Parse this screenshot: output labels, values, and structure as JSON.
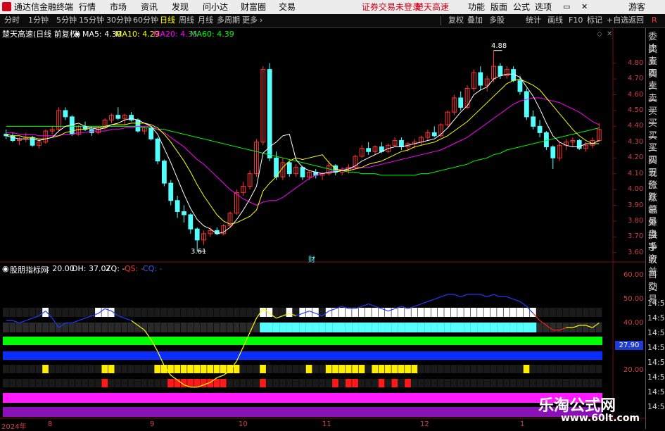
{
  "menu": {
    "app_title": "通达信金融终端",
    "items": [
      "行情",
      "市场",
      "资讯",
      "发现",
      "问小达",
      "财富圈",
      "交易"
    ],
    "notice": "证券交易未登录",
    "stock": "楚天高速",
    "right_items": [
      "功能",
      "版面",
      "公式",
      "选项"
    ],
    "user": "游客"
  },
  "toolbar": {
    "periods": [
      "分时",
      "1分钟",
      "5分钟",
      "15分钟",
      "30分钟",
      "60分钟",
      "日线",
      "周线",
      "月线",
      "多周期",
      "更多"
    ],
    "active_period": "日线",
    "right_buttons": [
      "复权",
      "叠加",
      "多股",
      "统计",
      "画线",
      "F10",
      "标记",
      "+自选",
      "返回"
    ]
  },
  "chart_header": {
    "title": "楚天高速(日线 前复权)",
    "ma5": "MA5: 4.30",
    "ma10": "MA10: 4.29",
    "ma20": "MA20: 4.35",
    "ma60": "MA60: 4.39"
  },
  "indicator_header": {
    "name": "股朋指标网",
    "v1": ": 20.00",
    "dh": "DH: 37.07",
    "zq": "ZQ: -",
    "qs": "QS: -",
    "cq": "CQ: -"
  },
  "price_axis": [
    "4.80",
    "4.70",
    "4.60",
    "4.50",
    "4.40",
    "4.30",
    "4.20",
    "4.10",
    "4.00",
    "3.90",
    "3.80",
    "3.70",
    "3.60"
  ],
  "ind_axis": [
    "60.00",
    "50.00",
    "40.00",
    "20.00"
  ],
  "ind_current": "27.90",
  "annotations": {
    "high": "4.88",
    "low": "3.61",
    "cai": "财"
  },
  "date_axis": [
    "2024年",
    "8",
    "9",
    "10",
    "11",
    "12",
    "1"
  ],
  "right_panel": {
    "labels": [
      "委比",
      "卖五",
      "卖四",
      "卖三",
      "卖二",
      "卖一",
      "买一",
      "买二",
      "买三",
      "买四",
      "买五",
      "现价",
      "涨跌",
      "涨幅",
      "总量",
      "外盘",
      "换手",
      "净资",
      "收益"
    ],
    "side": [
      "自动",
      "交易"
    ],
    "times": [
      "14:56",
      "14:56",
      "14:56",
      "14:56",
      "14:56",
      "14:56",
      "14:56",
      "14:56"
    ]
  },
  "watermark": {
    "title": "乐淘公式网",
    "url": "www.60lt.com"
  },
  "colors": {
    "up": "#ff3232",
    "down": "#54ffff",
    "ma5": "#ffffff",
    "ma10": "#ffff00",
    "ma20": "#ff00ff",
    "ma60": "#00ff00"
  },
  "chart_data": {
    "type": "candlestick",
    "ylim": [
      3.55,
      4.95
    ],
    "ohlc": [
      [
        4.35,
        4.38,
        4.32,
        4.34
      ],
      [
        4.34,
        4.36,
        4.3,
        4.31
      ],
      [
        4.31,
        4.33,
        4.28,
        4.32
      ],
      [
        4.32,
        4.36,
        4.3,
        4.33
      ],
      [
        4.33,
        4.34,
        4.27,
        4.28
      ],
      [
        4.28,
        4.32,
        4.26,
        4.3
      ],
      [
        4.3,
        4.38,
        4.29,
        4.37
      ],
      [
        4.37,
        4.4,
        4.35,
        4.38
      ],
      [
        4.38,
        4.52,
        4.37,
        4.5
      ],
      [
        4.5,
        4.52,
        4.44,
        4.46
      ],
      [
        4.46,
        4.47,
        4.34,
        4.35
      ],
      [
        4.35,
        4.41,
        4.34,
        4.4
      ],
      [
        4.4,
        4.43,
        4.37,
        4.38
      ],
      [
        4.38,
        4.4,
        4.34,
        4.36
      ],
      [
        4.36,
        4.4,
        4.35,
        4.39
      ],
      [
        4.39,
        4.45,
        4.38,
        4.44
      ],
      [
        4.44,
        4.48,
        4.42,
        4.47
      ],
      [
        4.47,
        4.52,
        4.44,
        4.45
      ],
      [
        4.45,
        4.48,
        4.41,
        4.47
      ],
      [
        4.47,
        4.49,
        4.43,
        4.44
      ],
      [
        4.44,
        4.45,
        4.36,
        4.37
      ],
      [
        4.37,
        4.4,
        4.35,
        4.39
      ],
      [
        4.39,
        4.4,
        4.31,
        4.32
      ],
      [
        4.32,
        4.33,
        4.16,
        4.18
      ],
      [
        4.18,
        4.19,
        4.02,
        4.04
      ],
      [
        4.04,
        4.06,
        3.9,
        3.93
      ],
      [
        3.93,
        3.96,
        3.82,
        3.86
      ],
      [
        3.86,
        3.9,
        3.79,
        3.84
      ],
      [
        3.84,
        3.85,
        3.72,
        3.75
      ],
      [
        3.75,
        3.76,
        3.61,
        3.68
      ],
      [
        3.68,
        3.74,
        3.65,
        3.72
      ],
      [
        3.72,
        3.76,
        3.7,
        3.74
      ],
      [
        3.74,
        3.76,
        3.71,
        3.72
      ],
      [
        3.72,
        3.78,
        3.71,
        3.77
      ],
      [
        3.77,
        3.86,
        3.76,
        3.85
      ],
      [
        3.85,
        4.0,
        3.84,
        3.98
      ],
      [
        3.98,
        4.05,
        3.96,
        4.02
      ],
      [
        4.02,
        4.12,
        4.0,
        4.1
      ],
      [
        4.1,
        4.32,
        4.08,
        4.3
      ],
      [
        4.3,
        4.78,
        4.28,
        4.76
      ],
      [
        4.76,
        4.8,
        4.18,
        4.2
      ],
      [
        4.2,
        4.24,
        4.06,
        4.08
      ],
      [
        4.08,
        4.2,
        4.06,
        4.17
      ],
      [
        4.17,
        4.18,
        4.08,
        4.1
      ],
      [
        4.1,
        4.16,
        4.08,
        4.14
      ],
      [
        4.14,
        4.15,
        4.06,
        4.08
      ],
      [
        4.08,
        4.12,
        4.06,
        4.11
      ],
      [
        4.11,
        4.13,
        4.07,
        4.09
      ],
      [
        4.09,
        4.11,
        4.06,
        4.1
      ],
      [
        4.1,
        4.18,
        4.09,
        4.15
      ],
      [
        4.15,
        4.16,
        4.09,
        4.11
      ],
      [
        4.11,
        4.14,
        4.09,
        4.12
      ],
      [
        4.12,
        4.16,
        4.1,
        4.14
      ],
      [
        4.14,
        4.22,
        4.13,
        4.21
      ],
      [
        4.21,
        4.28,
        4.2,
        4.26
      ],
      [
        4.26,
        4.3,
        4.22,
        4.24
      ],
      [
        4.24,
        4.28,
        4.22,
        4.27
      ],
      [
        4.27,
        4.3,
        4.23,
        4.24
      ],
      [
        4.24,
        4.29,
        4.23,
        4.28
      ],
      [
        4.28,
        4.33,
        4.27,
        4.31
      ],
      [
        4.31,
        4.33,
        4.25,
        4.27
      ],
      [
        4.27,
        4.3,
        4.24,
        4.29
      ],
      [
        4.29,
        4.32,
        4.26,
        4.3
      ],
      [
        4.3,
        4.34,
        4.28,
        4.33
      ],
      [
        4.33,
        4.38,
        4.31,
        4.36
      ],
      [
        4.36,
        4.4,
        4.33,
        4.34
      ],
      [
        4.34,
        4.42,
        4.33,
        4.41
      ],
      [
        4.41,
        4.5,
        4.4,
        4.49
      ],
      [
        4.49,
        4.6,
        4.47,
        4.58
      ],
      [
        4.58,
        4.62,
        4.5,
        4.52
      ],
      [
        4.52,
        4.66,
        4.51,
        4.64
      ],
      [
        4.64,
        4.76,
        4.62,
        4.74
      ],
      [
        4.74,
        4.78,
        4.63,
        4.66
      ],
      [
        4.66,
        4.72,
        4.62,
        4.7
      ],
      [
        4.7,
        4.88,
        4.68,
        4.78
      ],
      [
        4.78,
        4.8,
        4.7,
        4.72
      ],
      [
        4.72,
        4.78,
        4.7,
        4.76
      ],
      [
        4.76,
        4.78,
        4.68,
        4.69
      ],
      [
        4.69,
        4.72,
        4.6,
        4.62
      ],
      [
        4.62,
        4.64,
        4.44,
        4.46
      ],
      [
        4.46,
        4.5,
        4.38,
        4.4
      ],
      [
        4.4,
        4.44,
        4.33,
        4.36
      ],
      [
        4.36,
        4.37,
        4.25,
        4.27
      ],
      [
        4.27,
        4.28,
        4.13,
        4.2
      ],
      [
        4.2,
        4.3,
        4.18,
        4.28
      ],
      [
        4.28,
        4.32,
        4.25,
        4.3
      ],
      [
        4.3,
        4.33,
        4.27,
        4.31
      ],
      [
        4.31,
        4.32,
        4.25,
        4.26
      ],
      [
        4.26,
        4.3,
        4.24,
        4.28
      ],
      [
        4.28,
        4.33,
        4.26,
        4.31
      ],
      [
        4.31,
        4.42,
        4.3,
        4.38
      ]
    ],
    "ma5": [
      4.34,
      4.33,
      4.32,
      4.32,
      4.32,
      4.31,
      4.32,
      4.33,
      4.37,
      4.4,
      4.41,
      4.42,
      4.4,
      4.39,
      4.38,
      4.39,
      4.41,
      4.42,
      4.44,
      4.45,
      4.44,
      4.42,
      4.4,
      4.35,
      4.26,
      4.17,
      4.07,
      3.97,
      3.88,
      3.81,
      3.77,
      3.75,
      3.72,
      3.73,
      3.76,
      3.81,
      3.87,
      3.94,
      4.02,
      4.23,
      4.27,
      4.3,
      4.34,
      4.35,
      4.19,
      4.14,
      4.12,
      4.11,
      4.1,
      4.11,
      4.11,
      4.12,
      4.13,
      4.15,
      4.18,
      4.2,
      4.22,
      4.24,
      4.26,
      4.27,
      4.27,
      4.28,
      4.29,
      4.3,
      4.31,
      4.32,
      4.35,
      4.39,
      4.44,
      4.49,
      4.53,
      4.6,
      4.63,
      4.65,
      4.7,
      4.72,
      4.73,
      4.73,
      4.71,
      4.65,
      4.59,
      4.51,
      4.42,
      4.34,
      4.3,
      4.28,
      4.27,
      4.27,
      4.29,
      4.29,
      4.31
    ],
    "ma10": [
      4.35,
      4.34,
      4.34,
      4.33,
      4.33,
      4.32,
      4.32,
      4.33,
      4.34,
      4.36,
      4.37,
      4.38,
      4.38,
      4.39,
      4.39,
      4.4,
      4.41,
      4.41,
      4.41,
      4.42,
      4.42,
      4.42,
      4.41,
      4.39,
      4.35,
      4.3,
      4.24,
      4.18,
      4.11,
      4.03,
      3.96,
      3.9,
      3.84,
      3.8,
      3.78,
      3.79,
      3.81,
      3.83,
      3.87,
      3.99,
      4.04,
      4.08,
      4.14,
      4.18,
      4.2,
      4.19,
      4.2,
      4.21,
      4.22,
      4.17,
      4.13,
      4.12,
      4.12,
      4.13,
      4.14,
      4.16,
      4.17,
      4.18,
      4.2,
      4.22,
      4.24,
      4.25,
      4.27,
      4.28,
      4.29,
      4.3,
      4.32,
      4.34,
      4.37,
      4.4,
      4.43,
      4.47,
      4.51,
      4.55,
      4.59,
      4.63,
      4.67,
      4.69,
      4.7,
      4.68,
      4.66,
      4.63,
      4.58,
      4.53,
      4.48,
      4.43,
      4.38,
      4.34,
      4.31,
      4.29,
      4.29
    ],
    "ma20": [
      4.36,
      4.36,
      4.35,
      4.35,
      4.35,
      4.34,
      4.34,
      4.34,
      4.34,
      4.35,
      4.35,
      4.36,
      4.36,
      4.37,
      4.37,
      4.37,
      4.38,
      4.38,
      4.39,
      4.39,
      4.4,
      4.4,
      4.4,
      4.38,
      4.36,
      4.33,
      4.3,
      4.27,
      4.23,
      4.19,
      4.16,
      4.12,
      4.08,
      4.04,
      4.0,
      3.97,
      3.94,
      3.92,
      3.9,
      3.92,
      3.93,
      3.93,
      3.95,
      3.98,
      4.01,
      4.04,
      4.07,
      4.09,
      4.1,
      4.11,
      4.12,
      4.13,
      4.13,
      4.14,
      4.14,
      4.14,
      4.15,
      4.16,
      4.17,
      4.18,
      4.19,
      4.2,
      4.21,
      4.22,
      4.23,
      4.24,
      4.25,
      4.27,
      4.29,
      4.31,
      4.33,
      4.36,
      4.39,
      4.42,
      4.45,
      4.48,
      4.51,
      4.54,
      4.56,
      4.57,
      4.58,
      4.58,
      4.57,
      4.56,
      4.55,
      4.53,
      4.51,
      4.49,
      4.46,
      4.43,
      4.41
    ],
    "ma60": [
      4.4,
      4.4,
      4.4,
      4.4,
      4.4,
      4.4,
      4.4,
      4.4,
      4.4,
      4.4,
      4.4,
      4.4,
      4.4,
      4.4,
      4.4,
      4.4,
      4.4,
      4.4,
      4.4,
      4.4,
      4.4,
      4.39,
      4.39,
      4.38,
      4.38,
      4.37,
      4.36,
      4.35,
      4.34,
      4.33,
      4.32,
      4.31,
      4.3,
      4.29,
      4.28,
      4.27,
      4.26,
      4.25,
      4.24,
      4.23,
      4.22,
      4.21,
      4.2,
      4.19,
      4.18,
      4.17,
      4.16,
      4.15,
      4.14,
      4.13,
      4.12,
      4.12,
      4.11,
      4.11,
      4.1,
      4.1,
      4.1,
      4.09,
      4.09,
      4.09,
      4.09,
      4.09,
      4.09,
      4.1,
      4.1,
      4.11,
      4.12,
      4.13,
      4.14,
      4.15,
      4.16,
      4.18,
      4.19,
      4.2,
      4.22,
      4.23,
      4.25,
      4.26,
      4.27,
      4.28,
      4.29,
      4.3,
      4.31,
      4.32,
      4.33,
      4.34,
      4.35,
      4.36,
      4.37,
      4.38,
      4.39
    ],
    "indicator_line": [
      41,
      41,
      40,
      41,
      42,
      43,
      45,
      42,
      38,
      40,
      40,
      41,
      42,
      43,
      44,
      46,
      45,
      43,
      42,
      41,
      39,
      37,
      33,
      28,
      22,
      18,
      16,
      14,
      13,
      13,
      14,
      15,
      17,
      18,
      20,
      24,
      30,
      36,
      42,
      46,
      44,
      42,
      43,
      44,
      43,
      44,
      45,
      44,
      43,
      45,
      46,
      47,
      46,
      46,
      47,
      48,
      47,
      46,
      45,
      46,
      47,
      46,
      47,
      48,
      49,
      50,
      51,
      52,
      52,
      51,
      52,
      52,
      52,
      51,
      52,
      51,
      51,
      50,
      49,
      47,
      44,
      41,
      39,
      37,
      37,
      38,
      38,
      39,
      39,
      38,
      40
    ]
  }
}
